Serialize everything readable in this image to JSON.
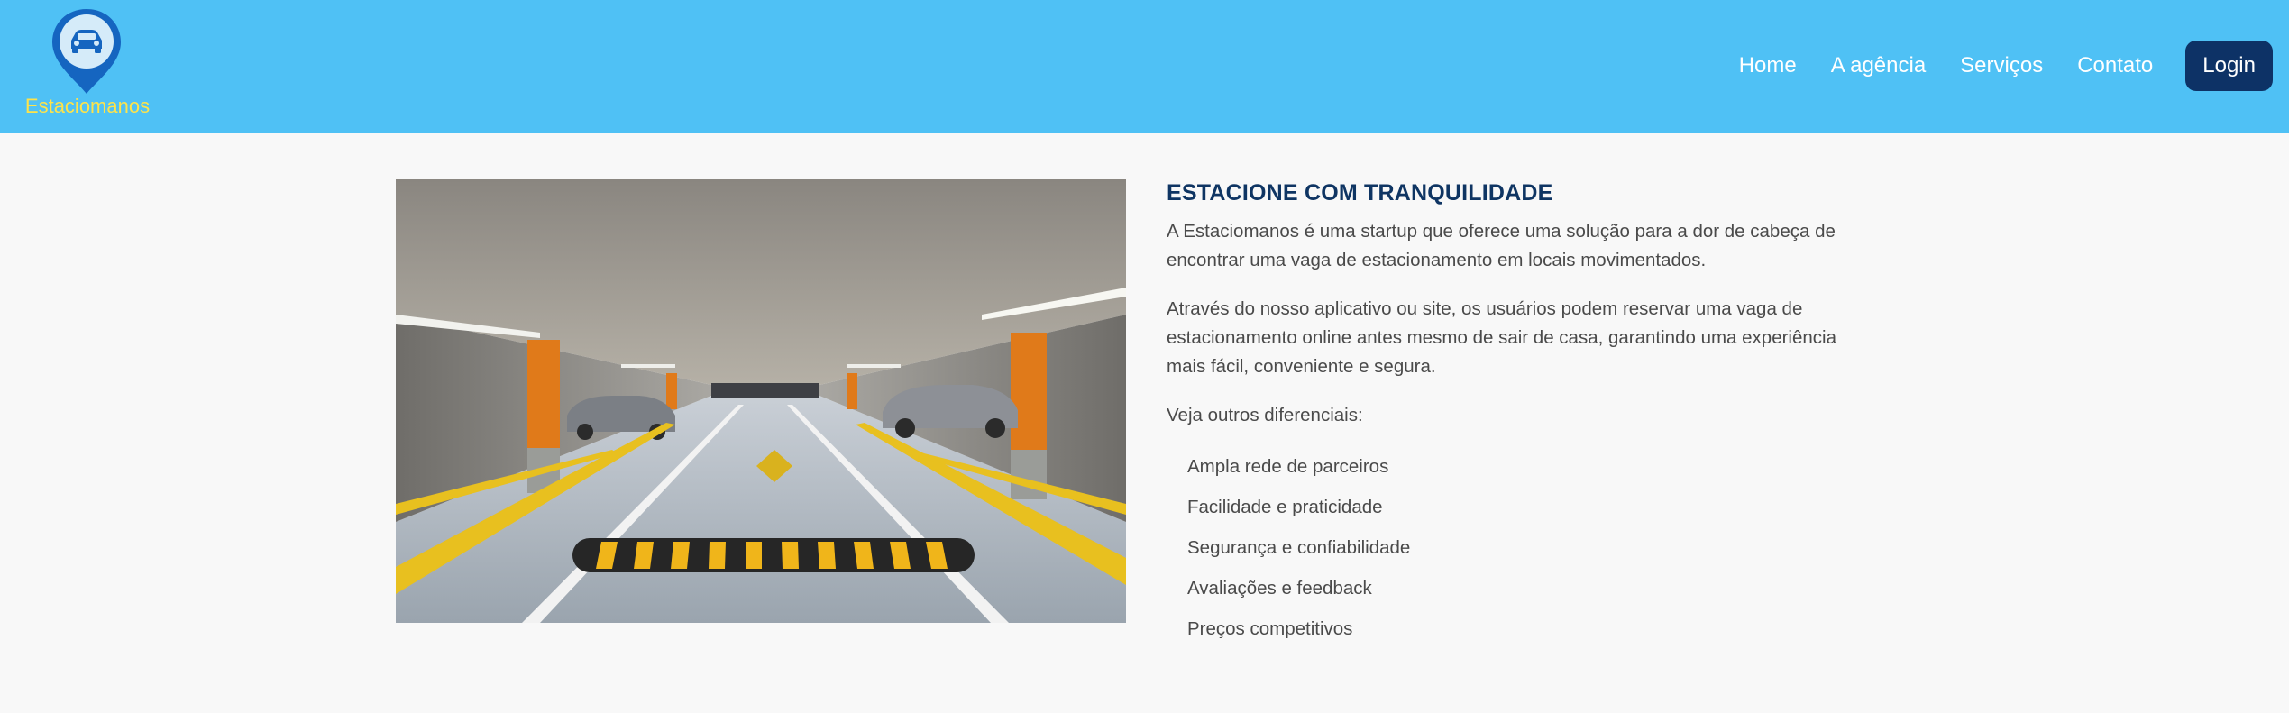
{
  "brand": {
    "name": "Estaciomanos",
    "logo_icon": "car-location-pin-icon",
    "colors": {
      "header_bg": "#4fc1f5",
      "brand_text": "#fde34b",
      "login_bg": "#0d3266",
      "heading": "#0f3563",
      "pin": "#1565c0"
    }
  },
  "nav": {
    "items": [
      {
        "label": "Home"
      },
      {
        "label": "A agência"
      },
      {
        "label": "Serviços"
      },
      {
        "label": "Contato"
      }
    ],
    "login_label": "Login"
  },
  "main": {
    "image": {
      "subject": "parking-garage-photo"
    },
    "title": "ESTACIONE COM TRANQUILIDADE",
    "paragraphs": [
      "A Estaciomanos é uma startup que oferece uma solução para a dor de cabeça de encontrar uma vaga de estacionamento em locais movimentados.",
      "Através do nosso aplicativo ou site, os usuários podem reservar uma vaga de estacionamento online antes mesmo de sair de casa, garantindo uma experiência mais fácil, conveniente e segura.",
      "Veja outros diferenciais:"
    ],
    "features": [
      "Ampla rede de parceiros",
      "Facilidade e praticidade",
      "Segurança e confiabilidade",
      "Avaliações e feedback",
      "Preços competitivos"
    ]
  }
}
